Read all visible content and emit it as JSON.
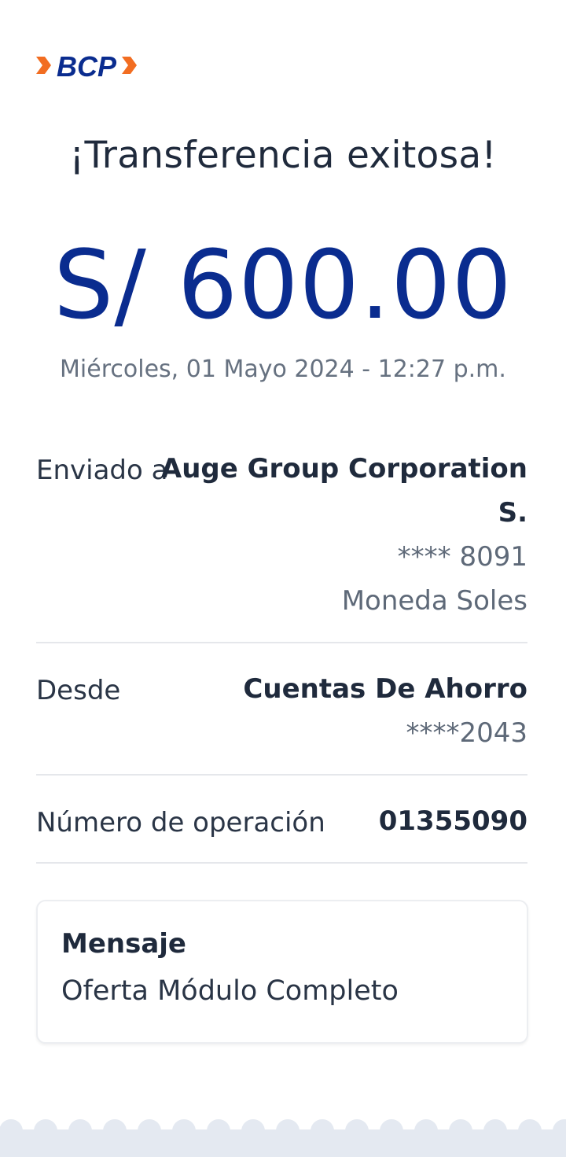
{
  "brand": {
    "logo_text": "BCP",
    "colors": {
      "blue": "#0a2c8f",
      "orange": "#f26d21",
      "text": "#1f2a3c",
      "muted": "#667180"
    }
  },
  "header": {
    "title": "¡Transferencia exitosa!"
  },
  "transfer": {
    "amount": "S/ 600.00",
    "datetime": "Miércoles, 01 Mayo 2024 - 12:27 p.m."
  },
  "details": {
    "recipient": {
      "label": "Enviado a",
      "name_line1": "Auge Group Corporation",
      "name_line2": "S.",
      "account": "**** 8091",
      "currency": "Moneda Soles"
    },
    "source": {
      "label": "Desde",
      "account_type": "Cuentas De Ahorro",
      "account": "****2043"
    },
    "operation": {
      "label": "Número de operación",
      "number": "01355090"
    }
  },
  "message": {
    "title": "Mensaje",
    "body": "Oferta Módulo Completo"
  }
}
